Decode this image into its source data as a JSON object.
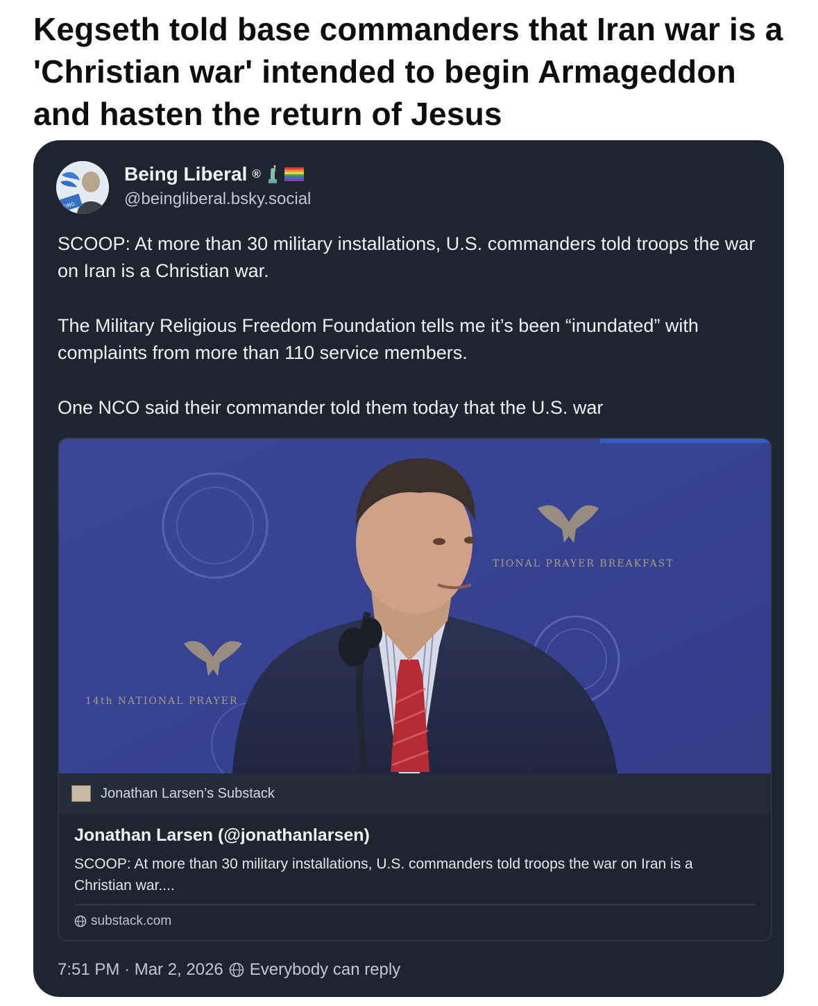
{
  "headline": "Kegseth told base commanders that Iran war is a 'Christian war' intended to begin Armageddon and hasten the return of Jesus",
  "post": {
    "author_name": "Being Liberal",
    "registered_mark": "®",
    "handle": "@beingliberal.bsky.social",
    "paragraphs": [
      "SCOOP: At more than 30 military installations, U.S. commanders told troops the war on Iran is a Christian war.",
      "The Military Religious Freedom Foundation tells me it’s been “inundated” with complaints from more than 110 service members.",
      "One NCO said their commander told them today that the U.S. war"
    ],
    "timestamp": "7:51 PM · Mar 2, 2026",
    "reply_setting": "Everybody can reply"
  },
  "embed": {
    "image_texts": {
      "backdrop_left": "14th NATIONAL PRAYER",
      "backdrop_right": "TIONAL PRAYER BREAKFAST"
    },
    "source_name": "Jonathan Larsen’s Substack",
    "title": "Jonathan Larsen (@jonathanlarsen)",
    "description": "SCOOP: At more than 30 military installations, U.S. commanders told troops the war on Iran is a Christian war....",
    "domain": "substack.com"
  },
  "colors": {
    "card_bg": "#1e2430",
    "backdrop_blue": "#3a4594",
    "text_primary": "#eef1f5",
    "text_secondary": "#c2c8d2"
  },
  "icons": [
    "avatar",
    "statue-of-liberty-icon",
    "rainbow-flag-icon",
    "globe-icon"
  ]
}
